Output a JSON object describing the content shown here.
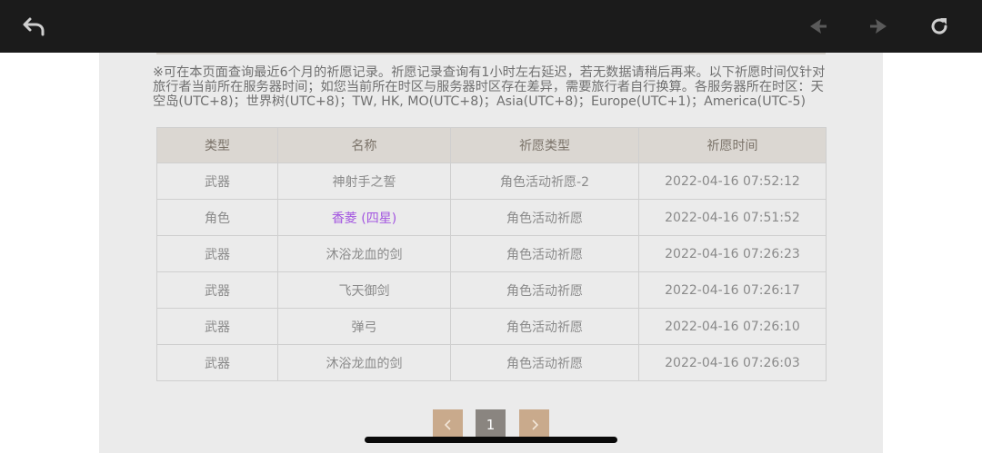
{
  "toolbar": {
    "back_icon": "back-arrow-icon",
    "prev_icon": "prev-page-icon",
    "next_icon": "next-page-icon",
    "refresh_icon": "refresh-icon"
  },
  "notice": "※可在本页面查询最近6个月的祈愿记录。祈愿记录查询有1小时左右延迟，若无数据请稍后再来。以下祈愿时间仅针对旅行者当前所在服务器时间；如您当前所在时区与服务器时区存在差异，需要旅行者自行换算。各服务器所在时区：天空岛(UTC+8)；世界树(UTC+8)；TW, HK, MO(UTC+8)；Asia(UTC+8)；Europe(UTC+1)；America(UTC-5)",
  "table": {
    "headers": [
      "类型",
      "名称",
      "祈愿类型",
      "祈愿时间"
    ],
    "rows": [
      {
        "type": "武器",
        "name": "神射手之誓",
        "wish": "角色活动祈愿-2",
        "time": "2022-04-16 07:52:12"
      },
      {
        "type": "角色",
        "name": "香菱 (四星)",
        "wish": "角色活动祈愿",
        "time": "2022-04-16 07:51:52"
      },
      {
        "type": "武器",
        "name": "沐浴龙血的剑",
        "wish": "角色活动祈愿",
        "time": "2022-04-16 07:26:23"
      },
      {
        "type": "武器",
        "name": "飞天御剑",
        "wish": "角色活动祈愿",
        "time": "2022-04-16 07:26:17"
      },
      {
        "type": "武器",
        "name": "弹弓",
        "wish": "角色活动祈愿",
        "time": "2022-04-16 07:26:10"
      },
      {
        "type": "武器",
        "name": "沐浴龙血的剑",
        "wish": "角色活动祈愿",
        "time": "2022-04-16 07:26:03"
      }
    ]
  },
  "pagination": {
    "current": "1",
    "prev_icon": "chevron-left-icon",
    "next_icon": "chevron-right-icon"
  },
  "colors": {
    "topbar": "#1b1b1b",
    "panel": "#ebebeb",
    "header_bg": "#dbd7d2",
    "four_star": "#a356e0",
    "pager_arrow": "#c9aa8c",
    "pager_current": "#8a8580"
  }
}
